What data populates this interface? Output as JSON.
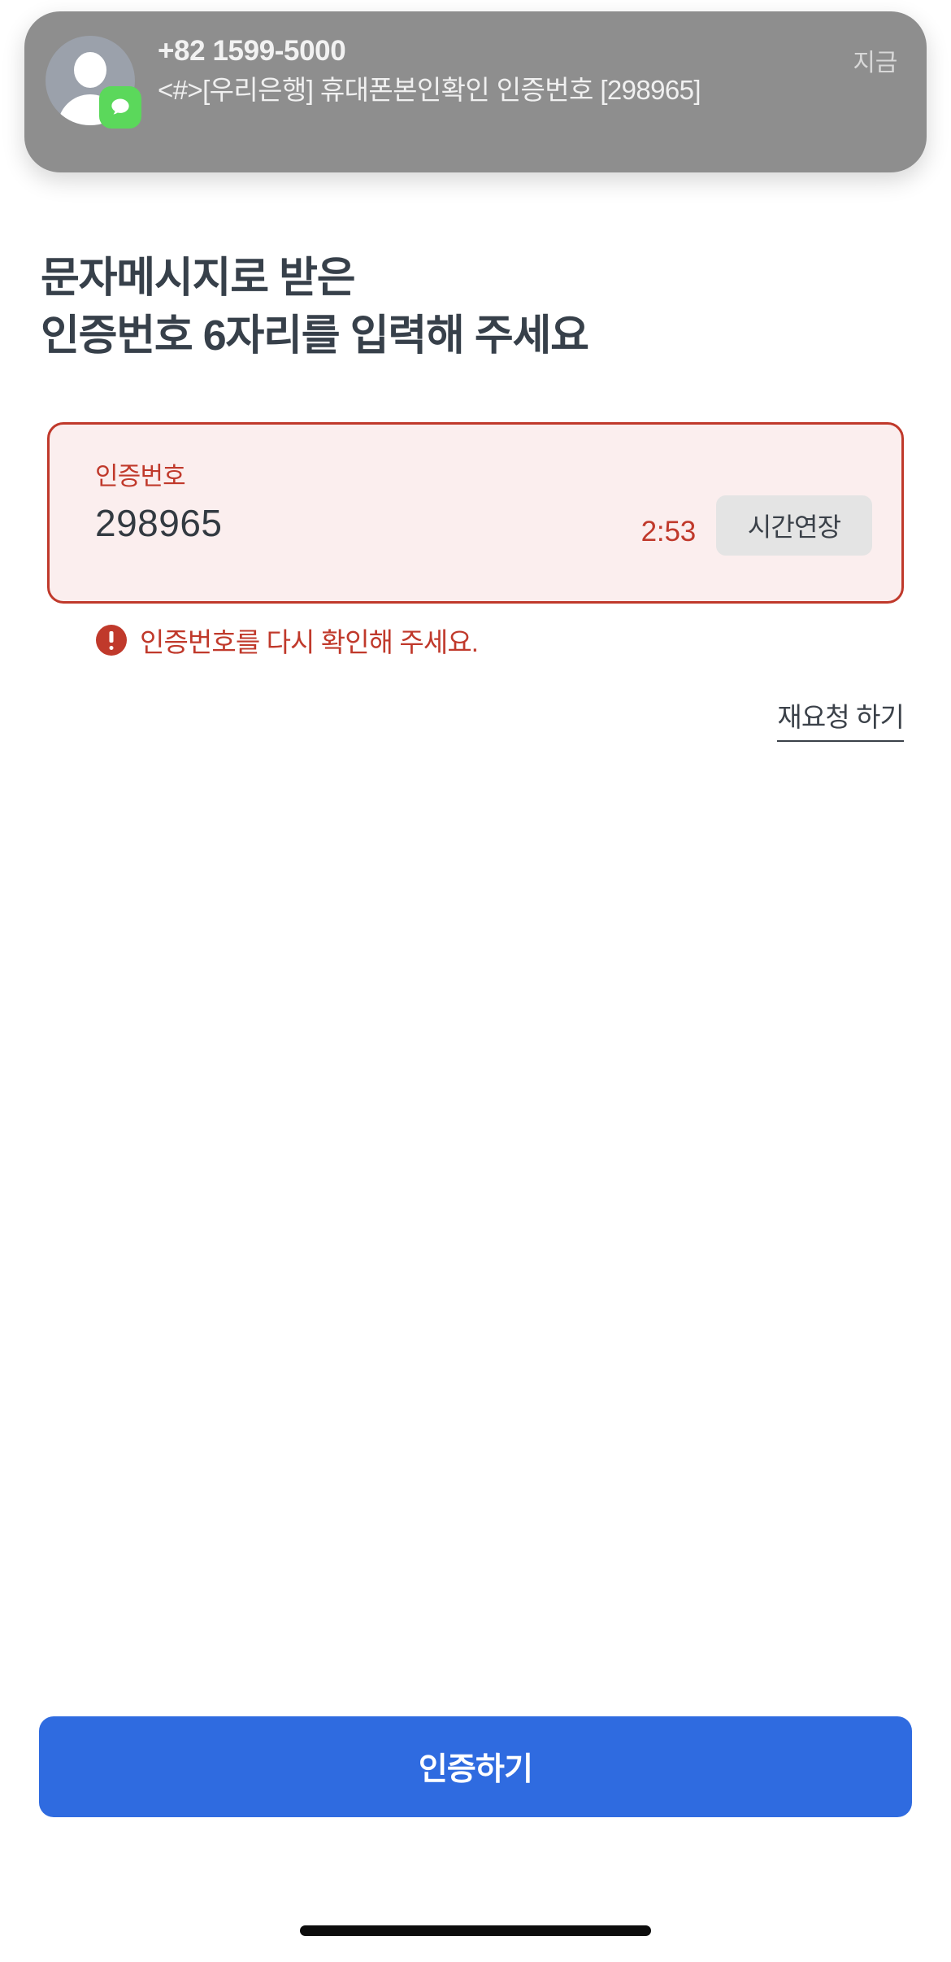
{
  "notification": {
    "sender": "+82 1599-5000",
    "message": "<#>[우리은행] 휴대폰본인확인 인증번호 [298965]",
    "time": "지금",
    "avatar_icon": "person-avatar-icon",
    "app_badge_icon": "messages-icon",
    "background_color": "#8e8e8e"
  },
  "heading": {
    "line1": "문자메시지로 받은",
    "line2": "인증번호 6자리를 입력해 주세요",
    "color": "#37404a"
  },
  "code_field": {
    "label": "인증번호",
    "value": "298965",
    "timer": "2:53",
    "extend_button_label": "시간연장",
    "border_color": "#c0392b",
    "background_color": "#fbeeee",
    "label_color": "#c0392b",
    "timer_color": "#c0392b"
  },
  "error": {
    "icon": "alert-circle-icon",
    "text": "인증번호를 다시 확인해 주세요.",
    "color": "#c0392b"
  },
  "resend": {
    "label": "재요청 하기"
  },
  "submit": {
    "label": "인증하기",
    "background_color": "#2f6be0",
    "text_color": "#ffffff"
  }
}
